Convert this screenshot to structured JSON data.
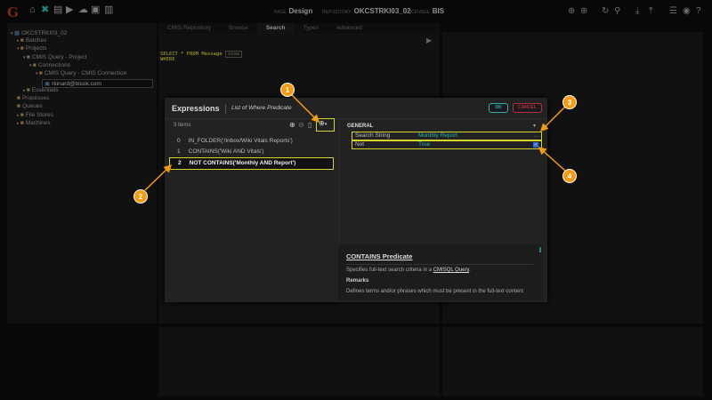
{
  "topbar": {
    "logo": "G",
    "page_label": "PAGE",
    "page": "Design",
    "repo_label": "REPOSITORY",
    "repo": "OKCSTRKI03_02",
    "licensee_label": "LICENSEE",
    "licensee": "BIS"
  },
  "tree": [
    {
      "label": "OKCSTRKI03_02",
      "depth": 0
    },
    {
      "label": "Batches",
      "depth": 1
    },
    {
      "label": "Projects",
      "depth": 1
    },
    {
      "label": "CMIS Query - Project",
      "depth": 2
    },
    {
      "label": "Connections",
      "depth": 3
    },
    {
      "label": "CMIS Query - CMIS Connection",
      "depth": 4
    },
    {
      "label": "rkinard@bisok.com",
      "depth": 5
    },
    {
      "label": "Essentials",
      "depth": 2
    },
    {
      "label": "Processes",
      "depth": 1
    },
    {
      "label": "Queues",
      "depth": 1
    },
    {
      "label": "File Stores",
      "depth": 1
    },
    {
      "label": "Machines",
      "depth": 1
    }
  ],
  "tabs": [
    "CMIS Repository",
    "Browse",
    "Search",
    "Types",
    "Advanced"
  ],
  "sql": {
    "line1": "SELECT * FROM Message",
    "tag": "view",
    "line2": "WHERE"
  },
  "modal": {
    "title": "Expressions",
    "subtitle": "List of Where Predicate",
    "ok": "OK",
    "cancel": "CANCEL",
    "count": "3 items",
    "items": [
      {
        "index": "0",
        "text": "IN_FOLDER('/Inbox/Wiki Vitals Reports')"
      },
      {
        "index": "1",
        "text": "CONTAINS('Wiki AND Vitals')"
      },
      {
        "index": "2",
        "text": "NOT CONTAINS('Monthly AND Report')"
      }
    ],
    "section": "GENERAL",
    "props": [
      {
        "name": "Search String",
        "value": "Monthly Report"
      },
      {
        "name": "Not",
        "value": "True"
      }
    ],
    "help": {
      "title": "CONTAINS Predicate",
      "desc": "Specifies full-text search criteria in a",
      "link": "CMISQL Query",
      "remarks": "Remarks",
      "body": "Defines terms and/or phrases which must be present in the full-text content"
    }
  },
  "annotations": [
    "1",
    "2",
    "3",
    "4"
  ],
  "colors": {
    "accent": "#f39c12",
    "highlight": "#d4d42a",
    "teal": "#2ab0b0"
  }
}
